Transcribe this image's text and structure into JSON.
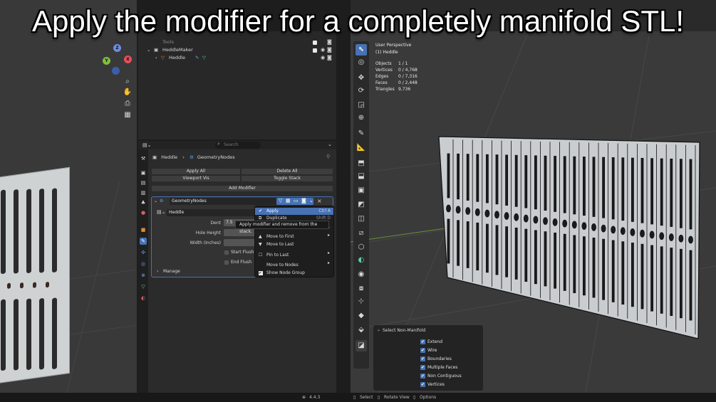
{
  "caption": "Apply the modifier for a completely manifold STL!",
  "outliner": {
    "rows": [
      {
        "label": "Tools"
      },
      {
        "label": "HeddleMaker"
      },
      {
        "label": "Heddle"
      }
    ]
  },
  "properties": {
    "search_placeholder": "Search",
    "breadcrumb": {
      "object": "Heddle",
      "modifier": "GeometryNodes"
    },
    "apply_all": "Apply All",
    "delete_all": "Delete All",
    "viewport_vis": "Viewport Vis",
    "toggle_stack": "Toggle Stack",
    "add_modifier": "Add Modifier",
    "modifier_name": "GeometryNodes",
    "node_group": "Heddle",
    "fields": [
      {
        "label": "Dent",
        "value": "7.5"
      },
      {
        "label": "Hole Height",
        "value": ""
      },
      {
        "label": "Width (Inches)",
        "value": ""
      }
    ],
    "start_flush": "Start Flush",
    "end_flush": "End Flush",
    "manage": "Manage"
  },
  "context_menu": {
    "items": [
      {
        "label": "Apply",
        "shortcut": "Ctrl A"
      },
      {
        "label": "Duplicate",
        "shortcut": "Shift D"
      },
      {
        "label": "Move to First",
        "shortcut": ""
      },
      {
        "label": "Move to Last",
        "shortcut": ""
      },
      {
        "label": "Pin to Last",
        "shortcut": ""
      },
      {
        "label": "Move to Nodes",
        "shortcut": ""
      },
      {
        "label": "Show Node Group",
        "shortcut": ""
      }
    ],
    "tooltip": "Apply modifier and remove from the stack."
  },
  "viewport": {
    "view_name": "User Perspective",
    "object_name": "(1) Heddle",
    "stats": [
      {
        "label": "Objects",
        "value": "1 / 1"
      },
      {
        "label": "Vertices",
        "value": "0 / 4,768"
      },
      {
        "label": "Edges",
        "value": "0 / 7,316"
      },
      {
        "label": "Faces",
        "value": "0 / 2,448"
      },
      {
        "label": "Triangles",
        "value": "9,736"
      }
    ]
  },
  "non_manifold": {
    "title": "Select Non-Manifold",
    "options": [
      {
        "label": "Extend",
        "checked": true
      },
      {
        "label": "Wire",
        "checked": true
      },
      {
        "label": "Boundaries",
        "checked": true
      },
      {
        "label": "Multiple Faces",
        "checked": true
      },
      {
        "label": "Non Contiguous",
        "checked": true
      },
      {
        "label": "Vertices",
        "checked": true
      }
    ]
  },
  "status_bar": {
    "version": "4.4.3",
    "select": "Select",
    "rotate_view": "Rotate View",
    "options": "Options"
  },
  "colors": {
    "accent": "#4772b3",
    "heddle_body": "#cfd2d3",
    "eye_brown": "#3a2a22"
  }
}
